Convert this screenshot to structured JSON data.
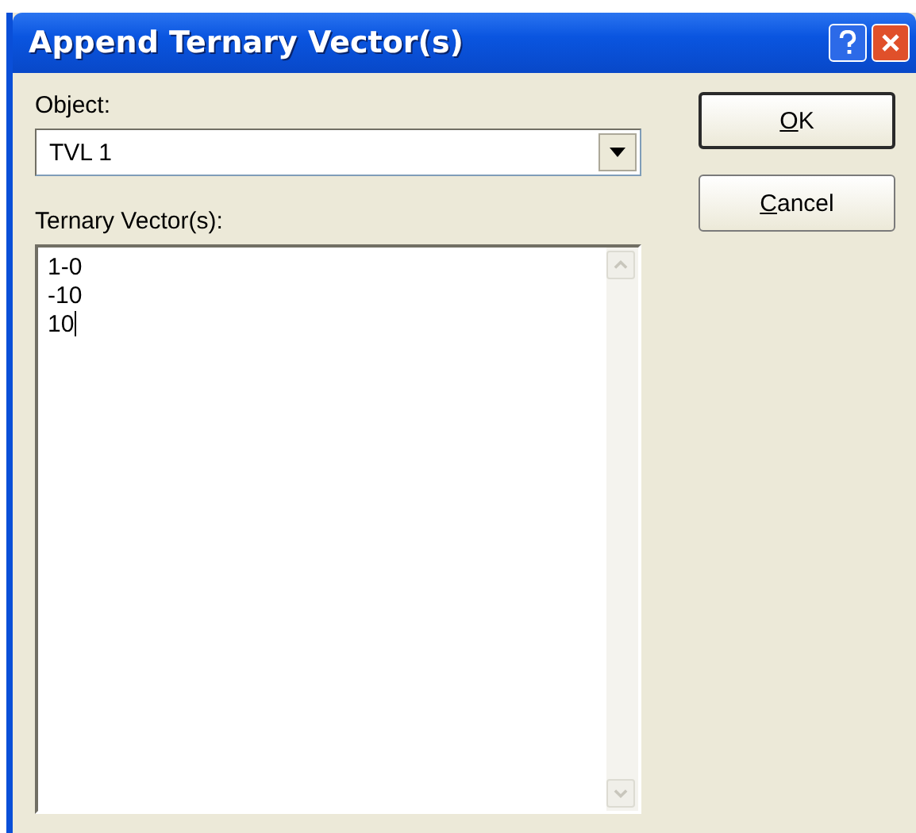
{
  "window": {
    "title": "Append Ternary Vector(s)"
  },
  "object": {
    "label": "Object:",
    "value": "TVL 1"
  },
  "vectors": {
    "label": "Ternary Vector(s):",
    "lines": [
      "1-0",
      "-10",
      "10"
    ]
  },
  "buttons": [
    {
      "label": "OK",
      "default": true
    },
    {
      "label": "Cancel",
      "default": false
    }
  ]
}
